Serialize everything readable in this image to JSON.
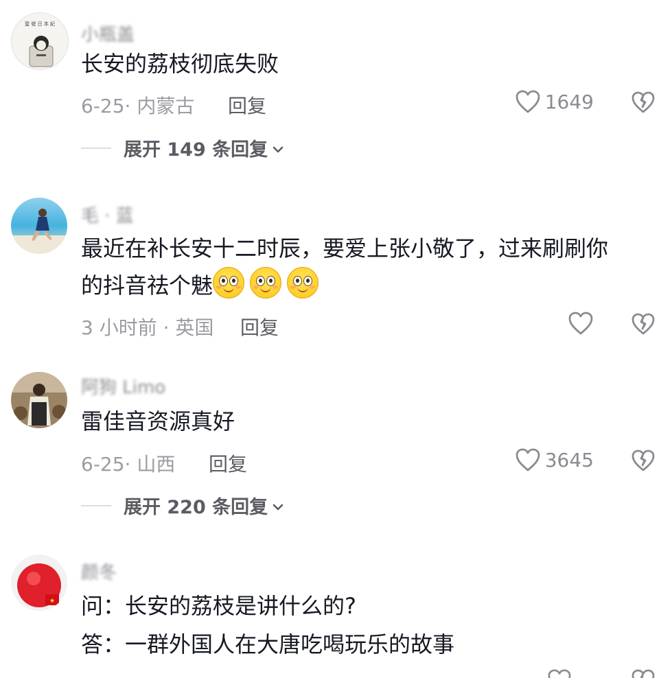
{
  "comments": [
    {
      "username": "小瓶盖",
      "text": "长安的荔枝彻底失败",
      "meta": "6-25· 内蒙古",
      "reply_label": "回复",
      "likes": "1649",
      "expand_label": "展开 149 条回复"
    },
    {
      "username": "毛 · 蓝",
      "text_line1": "最近在补长安十二时辰，要爱上张小敬了，过来刷刷你",
      "text_line2": "的抖音祛个魅",
      "meta": "3 小时前 · 英国",
      "reply_label": "回复"
    },
    {
      "username": "阿狗 Limo",
      "text": "雷佳音资源真好",
      "meta": "6-25· 山西",
      "reply_label": "回复",
      "likes": "3645",
      "expand_label": "展开 220 条回复"
    },
    {
      "username": "颜冬",
      "text_line1": "问：长安的荔枝是讲什么的?",
      "text_line2": "答：一群外国人在大唐吃喝玩乐的故事"
    }
  ],
  "icons": {
    "like": "heart-outline-icon",
    "dislike": "broken-heart-icon",
    "expand": "chevron-down-icon",
    "emoji": "smiling-face-emoji"
  },
  "colors": {
    "text": "#161823",
    "meta": "#9b9ca3",
    "icon": "#8a8b91"
  }
}
